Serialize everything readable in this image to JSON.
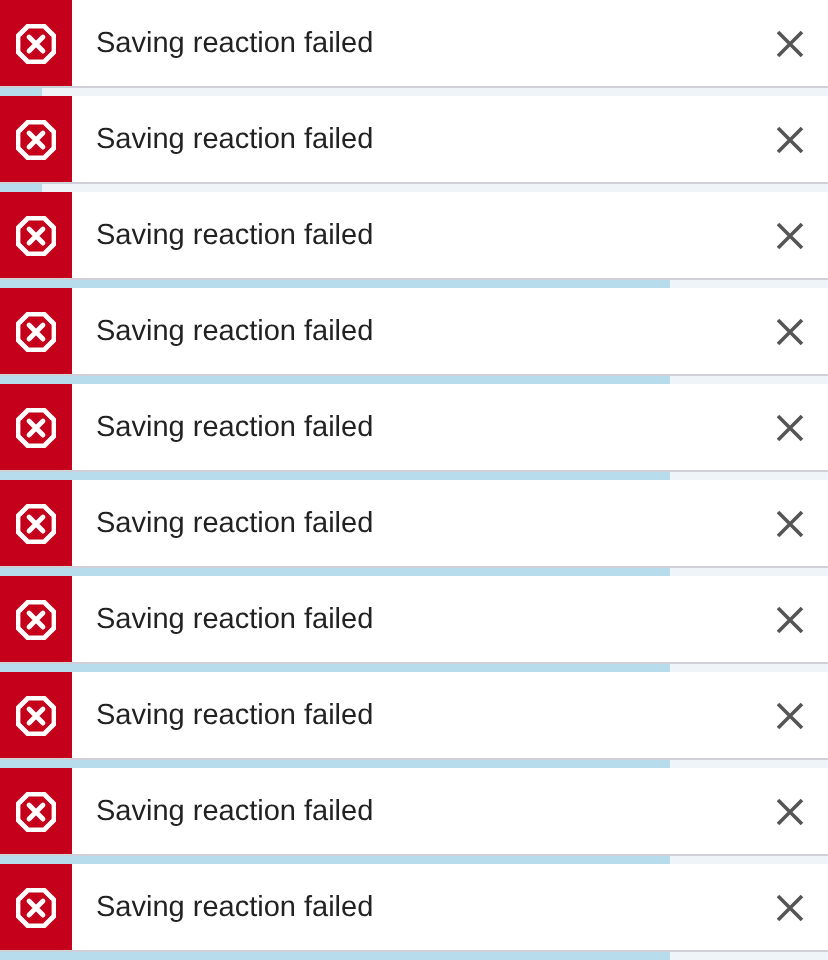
{
  "toasts": [
    {
      "message": "Saving reaction failed",
      "level": 0.05
    },
    {
      "message": "Saving reaction failed",
      "level": 0.05
    },
    {
      "message": "Saving reaction failed",
      "level": 0.81
    },
    {
      "message": "Saving reaction failed",
      "level": 0.81
    },
    {
      "message": "Saving reaction failed",
      "level": 0.81
    },
    {
      "message": "Saving reaction failed",
      "level": 0.81
    },
    {
      "message": "Saving reaction failed",
      "level": 0.81
    },
    {
      "message": "Saving reaction failed",
      "level": 0.81
    },
    {
      "message": "Saving reaction failed",
      "level": 0.81
    },
    {
      "message": "Saving reaction failed",
      "level": 0.81
    }
  ]
}
